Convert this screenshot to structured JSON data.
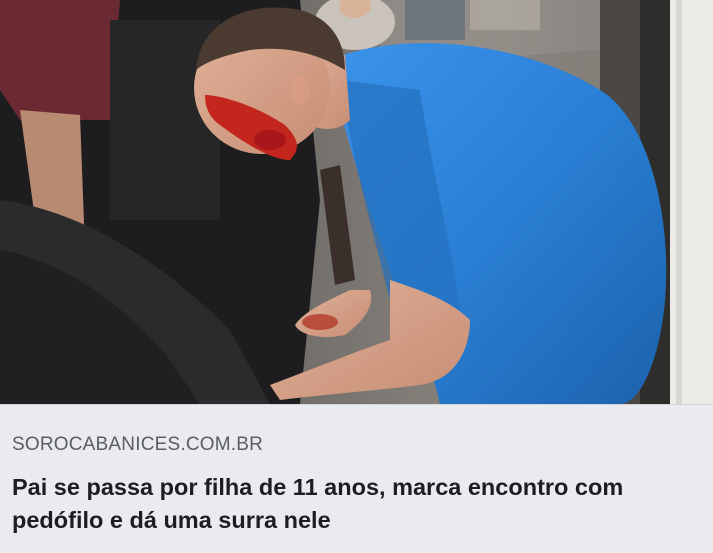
{
  "link_preview": {
    "photo_description": "",
    "source": "SOROCABANICES.COM.BR",
    "headline": "Pai se passa por filha de 11 anos, marca encontro com pedófilo e dá uma surra nele"
  },
  "colors": {
    "caption_background": "#eaebef",
    "source_text": "#5a5d63",
    "headline_text": "#1c1e21",
    "shirt_blue": "#2a7fd4"
  }
}
